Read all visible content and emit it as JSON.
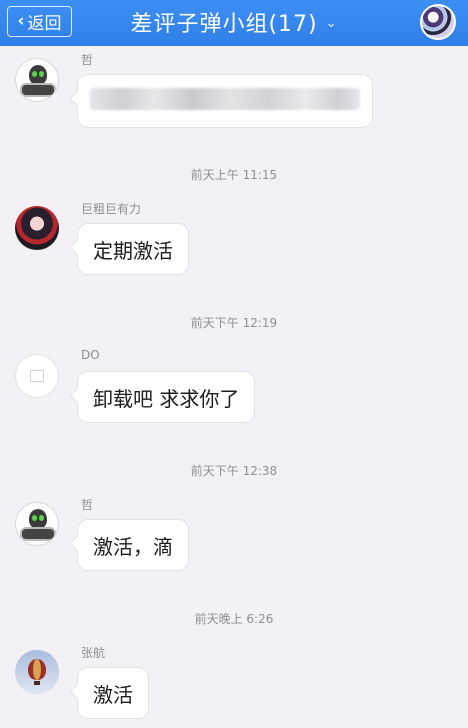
{
  "header": {
    "back_label": "返回",
    "title": "差评子弹小组(17)",
    "dropdown_glyph": "⌄"
  },
  "messages": [
    {
      "sender": "哲",
      "text": "",
      "redacted": true,
      "avatar_icon": "alien-avatar-icon"
    },
    {
      "sender": "巨粗巨有力",
      "text": "定期激活",
      "avatar_icon": "anime-avatar-icon"
    },
    {
      "sender": "DO",
      "text": "卸载吧 求求你了",
      "avatar_icon": "placeholder-avatar-icon"
    },
    {
      "sender": "哲",
      "text": "激活，滴",
      "avatar_icon": "alien-avatar-icon"
    },
    {
      "sender": "张航",
      "text": "激活",
      "avatar_icon": "balloon-avatar-icon"
    }
  ],
  "timestamps": [
    "前天上午 11:15",
    "前天下午 12:19",
    "前天下午 12:38",
    "前天晚上 6:26"
  ],
  "colors": {
    "header_blue": "#2f7fe8",
    "chat_background": "#f3f1f5",
    "bubble_white": "#ffffff",
    "meta_gray": "#8e8e93"
  }
}
